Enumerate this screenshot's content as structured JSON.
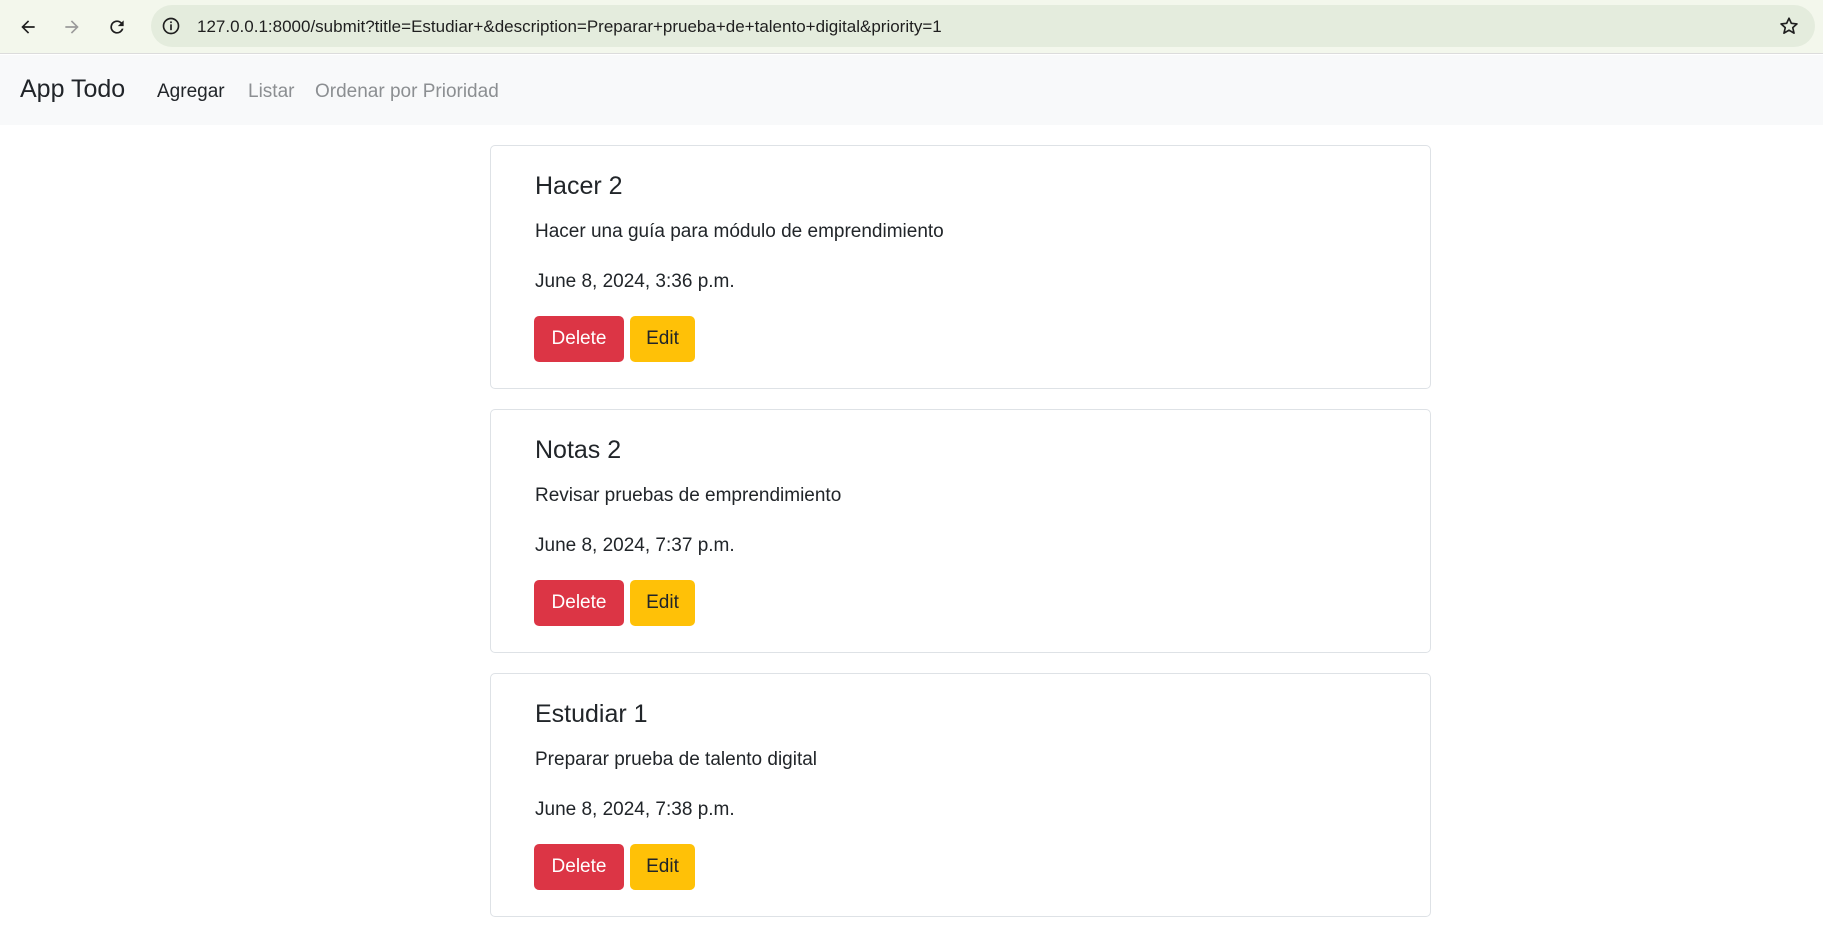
{
  "browser": {
    "url": "127.0.0.1:8000/submit?title=Estudiar+&description=Preparar+prueba+de+talento+digital&priority=1",
    "icons": {
      "back": "arrow-left-icon",
      "forward": "arrow-right-icon",
      "reload": "reload-icon",
      "info": "info-icon",
      "bookmark": "star-icon"
    }
  },
  "navbar": {
    "brand": "App Todo",
    "links": [
      {
        "label": "Agregar",
        "active": true
      },
      {
        "label": "Listar",
        "active": false
      },
      {
        "label": "Ordenar por Prioridad",
        "active": false
      }
    ]
  },
  "tasks": [
    {
      "title": "Hacer 2",
      "description": "Hacer una guía para módulo de emprendimiento",
      "date": "June 8, 2024, 3:36 p.m.",
      "delete_label": "Delete",
      "edit_label": "Edit"
    },
    {
      "title": "Notas 2",
      "description": "Revisar pruebas de emprendimiento",
      "date": "June 8, 2024, 7:37 p.m.",
      "delete_label": "Delete",
      "edit_label": "Edit"
    },
    {
      "title": "Estudiar 1",
      "description": "Preparar prueba de talento digital",
      "date": "June 8, 2024, 7:38 p.m.",
      "delete_label": "Delete",
      "edit_label": "Edit"
    }
  ],
  "colors": {
    "delete": "#dc3545",
    "edit": "#ffc107",
    "navbar_bg": "#f8f9fa",
    "browser_bg": "#f3f7ec",
    "omnibox_bg": "#e4ecdd"
  }
}
